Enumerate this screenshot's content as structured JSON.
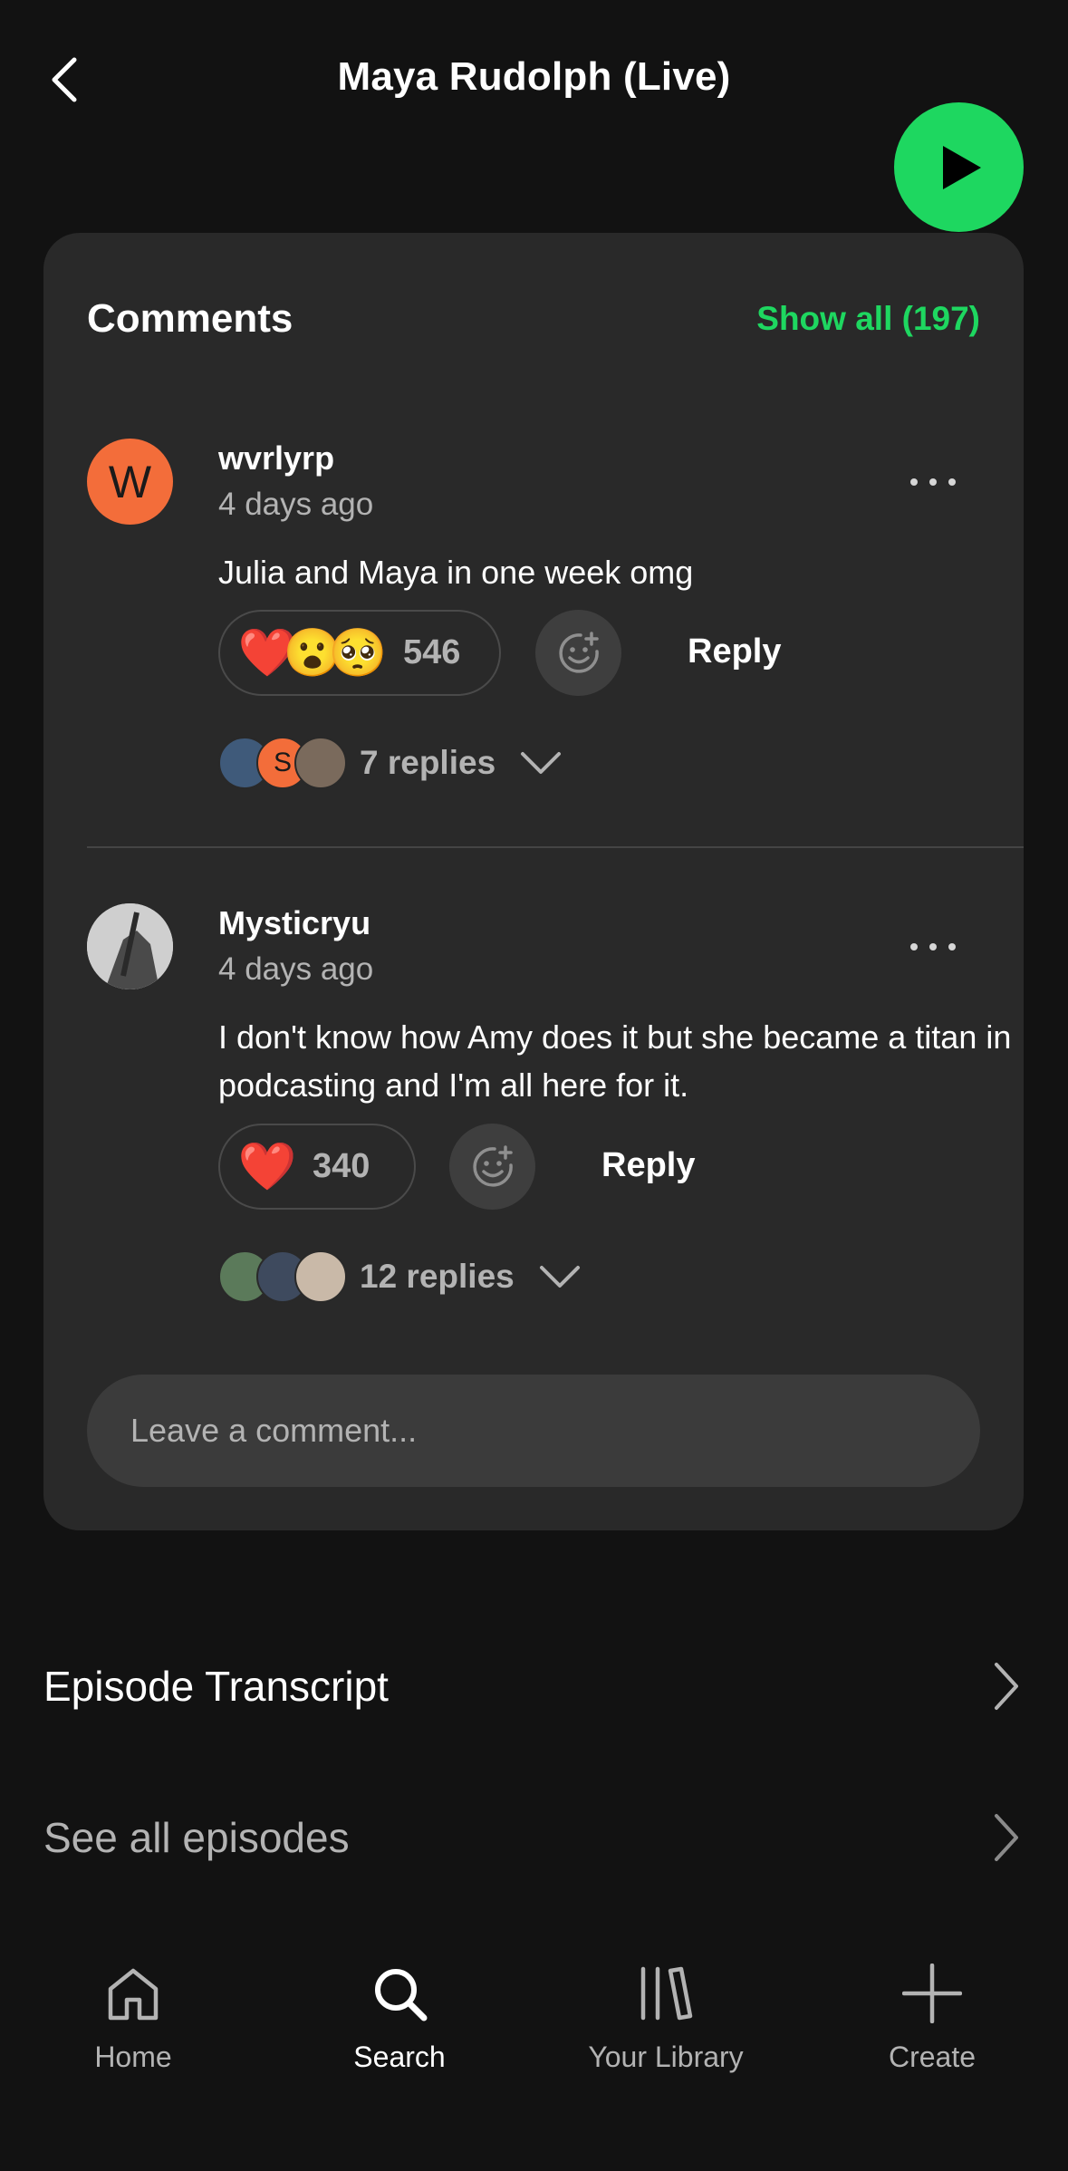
{
  "header": {
    "title": "Maya Rudolph (Live)"
  },
  "comments": {
    "title": "Comments",
    "show_all": "Show all (197)",
    "items": [
      {
        "avatar_letter": "W",
        "username": "wvrlyrp",
        "timestamp": "4 days ago",
        "text": "Julia and Maya in one week omg",
        "reactions": [
          "❤️",
          "😮",
          "🥺"
        ],
        "reaction_count": "546",
        "reply_label": "Reply",
        "replies_label": "7 replies",
        "reply_avatar_letter": "S"
      },
      {
        "username": "Mysticryu",
        "timestamp": "4 days ago",
        "text": "I don't know how Amy does it but she became a titan in podcasting and I'm all here for it.",
        "reactions": [
          "❤️"
        ],
        "reaction_count": "340",
        "reply_label": "Reply",
        "replies_label": "12 replies"
      }
    ],
    "input_placeholder": "Leave a comment..."
  },
  "rows": {
    "transcript": "Episode Transcript",
    "all_episodes": "See all episodes"
  },
  "nav": {
    "home": "Home",
    "search": "Search",
    "library": "Your Library",
    "create": "Create"
  },
  "colors": {
    "accent": "#1ed760",
    "background": "#121212",
    "card": "#292929",
    "avatar_orange": "#f36d3a"
  }
}
